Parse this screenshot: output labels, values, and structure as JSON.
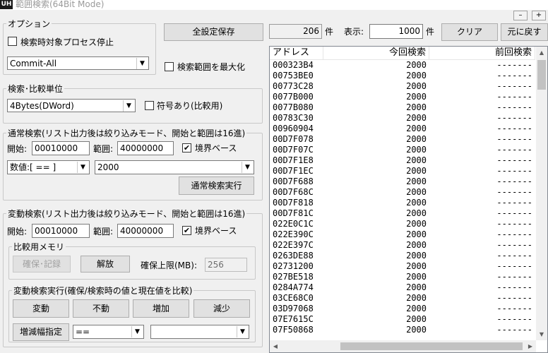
{
  "window": {
    "title": "範囲検索(64Bit Mode)",
    "icon": "UH"
  },
  "window_controls": {
    "minimize": "–",
    "maximize": "+"
  },
  "options": {
    "legend": "オプション",
    "stop_process_label": "検索時対象プロセス停止",
    "stop_process_checked": false,
    "memory_type": "Commit-All",
    "save_all_button": "全設定保存",
    "maximize_range_label": "検索範囲を最大化",
    "maximize_range_checked": false
  },
  "compare_unit": {
    "legend": "検索･比較単位",
    "value": "4Bytes(DWord)",
    "signed_label": "符号あり(比較用)",
    "signed_checked": false
  },
  "normal_search": {
    "legend": "通常検索(リスト出力後は絞り込みモード、開始と範囲は16進)",
    "start_label": "開始:",
    "start_value": "00010000",
    "range_label": "範囲:",
    "range_value": "40000000",
    "boundary_label": "境界ベース",
    "boundary_checked": true,
    "condition": "数値:[ == ]",
    "value": "2000",
    "execute_button": "通常検索実行"
  },
  "change_search": {
    "legend": "変動検索(リスト出力後は絞り込みモード、開始と範囲は16進)",
    "start_label": "開始:",
    "start_value": "00010000",
    "range_label": "範囲:",
    "range_value": "40000000",
    "boundary_label": "境界ベース",
    "boundary_checked": true,
    "memory": {
      "legend": "比較用メモリ",
      "secure_button": "確保･記録",
      "release_button": "解放",
      "limit_label": "確保上限(MB):",
      "limit_value": "256"
    },
    "exec": {
      "legend": "変動検索実行(確保/検索時の値と現在値を比較)",
      "changed_button": "変動",
      "unchanged_button": "不動",
      "increased_button": "増加",
      "decreased_button": "減少",
      "delta_button": "増減幅指定",
      "delta_operator": "==",
      "delta_value": ""
    }
  },
  "results": {
    "count": "206",
    "count_unit": "件",
    "display_label": "表示:",
    "display_value": "1000",
    "display_unit": "件",
    "clear_button": "クリア",
    "restore_button": "元に戻す",
    "columns": [
      "アドレス",
      "今回検索",
      "前回検索"
    ],
    "rows": [
      [
        "000323B4",
        "2000",
        "-------"
      ],
      [
        "00753BE0",
        "2000",
        "-------"
      ],
      [
        "00773C28",
        "2000",
        "-------"
      ],
      [
        "0077B000",
        "2000",
        "-------"
      ],
      [
        "0077B080",
        "2000",
        "-------"
      ],
      [
        "00783C30",
        "2000",
        "-------"
      ],
      [
        "00960904",
        "2000",
        "-------"
      ],
      [
        "00D7F078",
        "2000",
        "-------"
      ],
      [
        "00D7F07C",
        "2000",
        "-------"
      ],
      [
        "00D7F1E8",
        "2000",
        "-------"
      ],
      [
        "00D7F1EC",
        "2000",
        "-------"
      ],
      [
        "00D7F688",
        "2000",
        "-------"
      ],
      [
        "00D7F68C",
        "2000",
        "-------"
      ],
      [
        "00D7F818",
        "2000",
        "-------"
      ],
      [
        "00D7F81C",
        "2000",
        "-------"
      ],
      [
        "022E0C1C",
        "2000",
        "-------"
      ],
      [
        "022E390C",
        "2000",
        "-------"
      ],
      [
        "022E397C",
        "2000",
        "-------"
      ],
      [
        "0263DE88",
        "2000",
        "-------"
      ],
      [
        "02731200",
        "2000",
        "-------"
      ],
      [
        "027BE518",
        "2000",
        "-------"
      ],
      [
        "0284A774",
        "2000",
        "-------"
      ],
      [
        "03CE68C0",
        "2000",
        "-------"
      ],
      [
        "03D97068",
        "2000",
        "-------"
      ],
      [
        "07E7615C",
        "2000",
        "-------"
      ],
      [
        "07F50868",
        "2000",
        "-------"
      ]
    ]
  }
}
